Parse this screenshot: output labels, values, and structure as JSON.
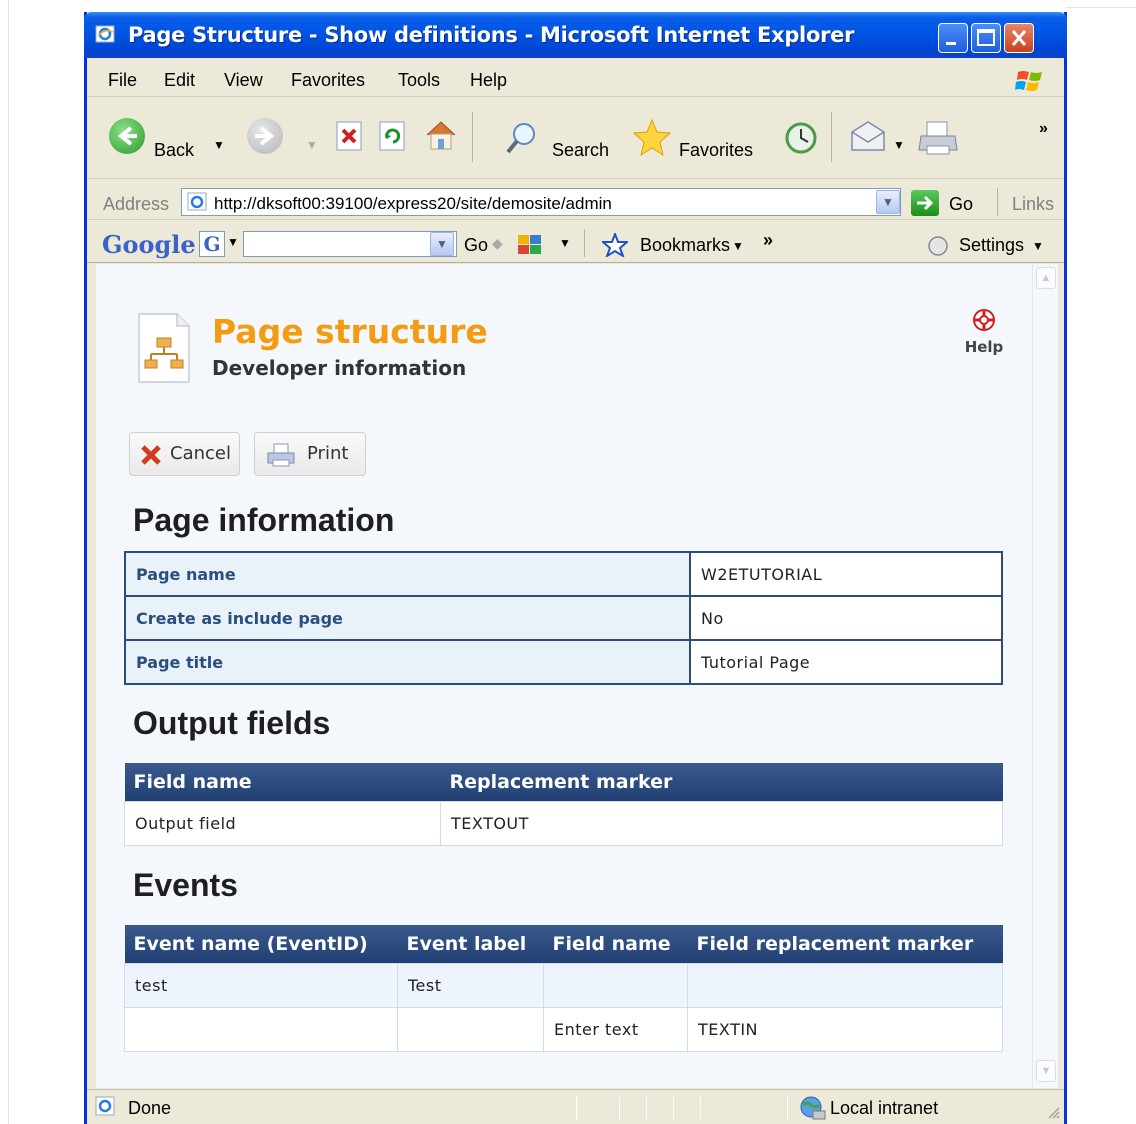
{
  "window": {
    "title": "Page Structure - Show definitions - Microsoft Internet Explorer"
  },
  "menu": [
    "File",
    "Edit",
    "View",
    "Favorites",
    "Tools",
    "Help"
  ],
  "toolbar": {
    "back": "Back",
    "search": "Search",
    "favorites": "Favorites",
    "more": "»"
  },
  "address": {
    "label": "Address",
    "url": "http://dksoft00:39100/express20/site/demosite/admin",
    "go": "Go",
    "links": "Links"
  },
  "google": {
    "logo": "Google",
    "go": "Go",
    "bookmarks": "Bookmarks",
    "more": "»",
    "settings": "Settings"
  },
  "page": {
    "title": "Page structure",
    "subtitle": "Developer information",
    "help": "Help",
    "cancel": "Cancel",
    "print": "Print"
  },
  "page_info": {
    "heading": "Page information",
    "rows": [
      {
        "key": "Page name",
        "value": "W2ETUTORIAL"
      },
      {
        "key": "Create as include page",
        "value": "No"
      },
      {
        "key": "Page title",
        "value": "Tutorial Page"
      }
    ]
  },
  "output_fields": {
    "heading": "Output fields",
    "columns": [
      "Field name",
      "Replacement marker"
    ],
    "rows": [
      [
        "Output field",
        "TEXTOUT"
      ]
    ]
  },
  "events": {
    "heading": "Events",
    "columns": [
      "Event name (EventID)",
      "Event label",
      "Field name",
      "Field replacement marker"
    ],
    "rows": [
      [
        "test",
        "Test",
        "",
        ""
      ],
      [
        "",
        "",
        "Enter text",
        "TEXTIN"
      ]
    ]
  },
  "status": {
    "text": "Done",
    "zone": "Local intranet"
  },
  "colors": {
    "accent_title": "#f39c12",
    "table_header": "#2e4d7b",
    "xp_titlebar": "#0055e5"
  }
}
